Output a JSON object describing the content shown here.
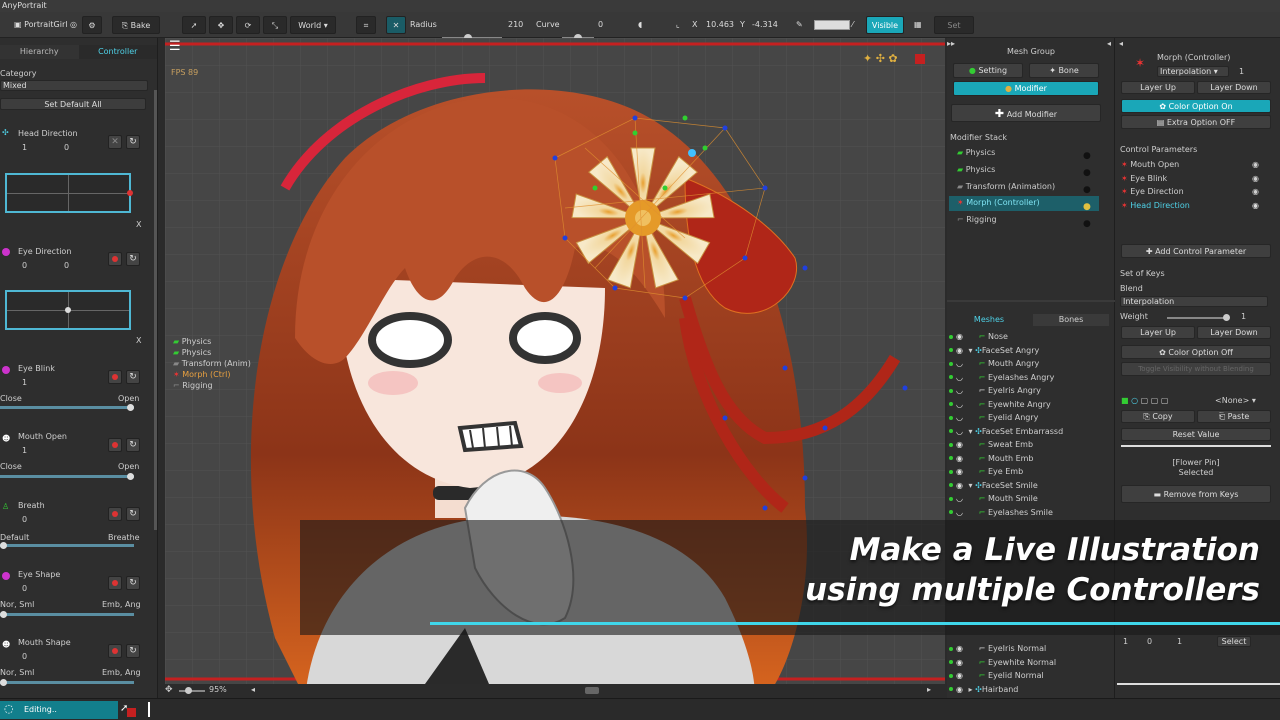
{
  "window": {
    "title": "AnyPortrait"
  },
  "toolbar": {
    "project": "PortraitGirl",
    "bake": "Bake",
    "space": "World",
    "radius_label": "Radius",
    "radius_value": "210",
    "curve_label": "Curve",
    "curve_value": "0",
    "x_label": "X",
    "x_value": "10.463",
    "y_label": "Y",
    "y_value": "-4.314",
    "visible": "Visible",
    "set_label": "Set"
  },
  "left": {
    "tabs": [
      "Hierarchy",
      "Controller"
    ],
    "category_label": "Category",
    "category_value": "Mixed",
    "set_default_all": "Set Default All",
    "params": [
      {
        "name": "Head Direction",
        "v1": "1",
        "v2": "0"
      },
      {
        "name": "Eye Direction",
        "v1": "0",
        "v2": "0"
      },
      {
        "name": "Eye Blink",
        "v1": "1",
        "min": "Close",
        "max": "Open"
      },
      {
        "name": "Mouth Open",
        "v1": "1",
        "min": "Close",
        "max": "Open"
      },
      {
        "name": "Breath",
        "v1": "0",
        "min": "Default",
        "max": "Breathe"
      },
      {
        "name": "Eye Shape",
        "v1": "0",
        "min": "Nor, Sml",
        "max": "Emb, Ang"
      },
      {
        "name": "Mouth Shape",
        "v1": "0",
        "min": "Nor, Sml",
        "max": "Emb, Ang"
      }
    ],
    "x_axis": "X"
  },
  "canvas": {
    "fps": "FPS 89",
    "zoom": "95%",
    "stack": [
      "Physics",
      "Physics",
      "Transform (Anim)",
      "Morph (Ctrl)",
      "Rigging"
    ]
  },
  "caption": {
    "line1": "Make a Live Illustration",
    "line2": "using multiple Controllers"
  },
  "mesh_group": {
    "title": "Mesh Group",
    "setting": "Setting",
    "bone": "Bone",
    "modifier": "Modifier",
    "add_modifier": "Add Modifier",
    "stack_label": "Modifier Stack",
    "stack": [
      "Physics",
      "Physics",
      "Transform (Animation)",
      "Morph (Controller)",
      "Rigging"
    ],
    "tabs": [
      "Meshes",
      "Bones"
    ],
    "meshes": [
      "Nose",
      "FaceSet Angry",
      "Mouth Angry",
      "Eyelashes Angry",
      "EyeIris Angry",
      "Eyewhite Angry",
      "Eyelid Angry",
      "FaceSet Embarrassd",
      "Sweat Emb",
      "Mouth Emb",
      "Eye Emb",
      "FaceSet Smile",
      "Mouth Smile",
      "Eyelashes Smile"
    ],
    "meshes_bottom": [
      "EyeIris Normal",
      "Eyewhite Normal",
      "Eyelid Normal",
      "Hairband"
    ]
  },
  "morph": {
    "title": "Morph (Controller)",
    "interpolation": "Interpolation",
    "interp_num": "1",
    "layer_up": "Layer Up",
    "layer_down": "Layer Down",
    "color_option_on": "Color Option On",
    "extra_option_off": "Extra Option OFF",
    "control_params_label": "Control Parameters",
    "control_params": [
      "Mouth Open",
      "Eye Blink",
      "Eye Direction",
      "Head Direction"
    ],
    "add_control_param": "Add Control Parameter",
    "set_of_keys": "Set of Keys",
    "blend_label": "Blend",
    "blend_value": "Interpolation",
    "weight_label": "Weight",
    "weight_value": "1",
    "layer_up2": "Layer Up",
    "layer_down2": "Layer Down",
    "color_option_off": "Color Option Off",
    "visibility": "Toggle Visibility without Blending",
    "none": "<None>",
    "copy": "Copy",
    "paste": "Paste",
    "reset_value": "Reset Value",
    "selected_line1": "[Flower Pin]",
    "selected_line2": "Selected",
    "remove_keys": "Remove from Keys",
    "bottom_row": [
      "1",
      "0",
      "1"
    ],
    "select": "Select"
  },
  "status": {
    "text": "Editing.."
  },
  "colors": {
    "accent": "#4fd2e8",
    "cyan_button": "#1aa7b8",
    "warn": "#d33"
  }
}
